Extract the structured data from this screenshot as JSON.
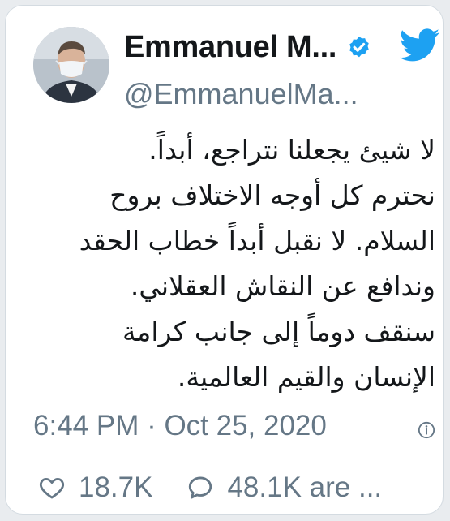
{
  "author": {
    "name": "Emmanuel M...",
    "handle": "@EmmanuelMa...",
    "verified": true,
    "avatar": "avatar-photo"
  },
  "tweet": {
    "lines": [
      "لا شيئ يجعلنا نتراجع، أبداً.",
      "نحترم كل أوجه الاختلاف بروح",
      "السلام. لا نقبل أبداً خطاب الحقد",
      "وندافع عن النقاش العقلاني.",
      "سنقف دوماً إلى جانب كرامة",
      "الإنسان والقيم العالمية."
    ]
  },
  "meta": {
    "timestamp": "6:44 PM · Oct 25, 2020",
    "info_icon": "info-icon"
  },
  "actions": {
    "likes_count": "18.7K",
    "replies_label": "48.1K are ..."
  },
  "colors": {
    "twitter_blue": "#1da1f2",
    "text": "#14171a",
    "muted": "#657786"
  }
}
